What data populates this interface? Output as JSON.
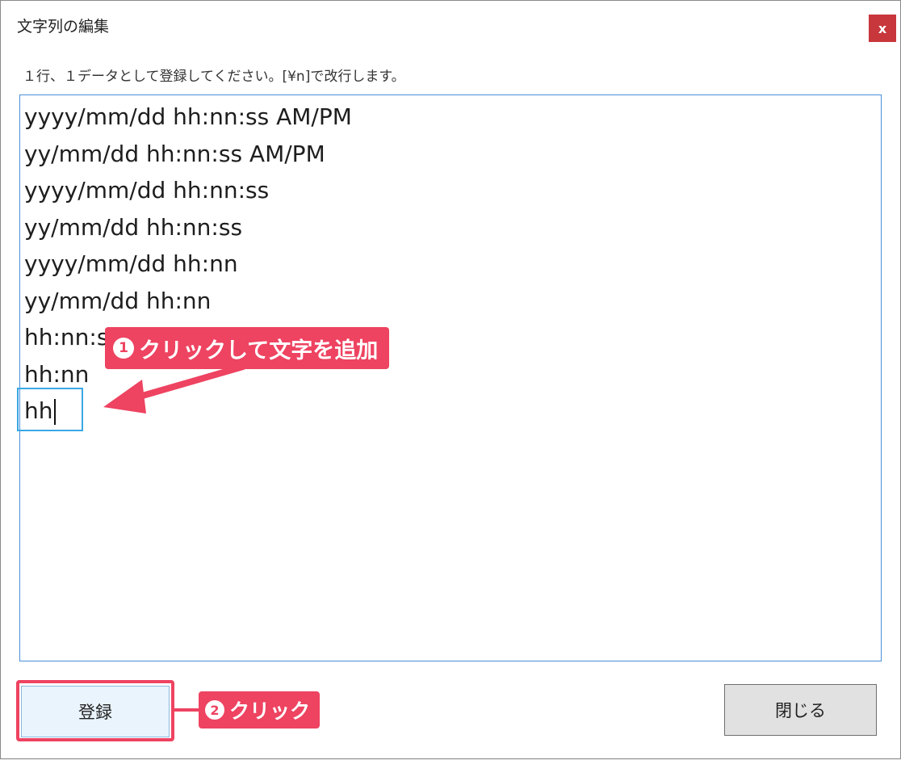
{
  "dialog": {
    "title": "文字列の編集",
    "close_label": "x",
    "instruction": "１行、１データとして登録してください。[¥n]で改行します。"
  },
  "editor": {
    "lines": [
      "yyyy/mm/dd hh:nn:ss AM/PM",
      "yy/mm/dd hh:nn:ss AM/PM",
      "yyyy/mm/dd hh:nn:ss",
      "yy/mm/dd hh:nn:ss",
      "yyyy/mm/dd hh:nn",
      "yy/mm/dd hh:nn",
      "hh:nn:ss",
      "hh:nn",
      "hh"
    ]
  },
  "annotations": {
    "step1_number": "1",
    "step1_text": "クリックして文字を追加",
    "step2_number": "2",
    "step2_text": "クリック"
  },
  "buttons": {
    "register_label": "登録",
    "close_label": "閉じる"
  },
  "colors": {
    "accent": "#ee4361",
    "focus": "#3aa7e6",
    "close_button": "#c8373b"
  }
}
